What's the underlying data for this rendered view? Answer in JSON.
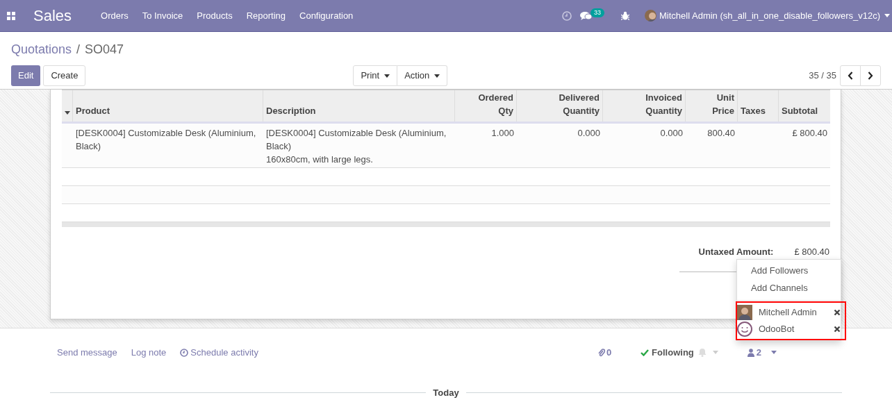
{
  "navbar": {
    "app_name": "Sales",
    "menu": [
      "Orders",
      "To Invoice",
      "Products",
      "Reporting",
      "Configuration"
    ],
    "messages_badge": "33",
    "user": "Mitchell Admin (sh_all_in_one_disable_followers_v12c)"
  },
  "breadcrumb": {
    "parent": "Quotations",
    "separator": "/",
    "current": "SO047"
  },
  "buttons": {
    "edit": "Edit",
    "create": "Create",
    "print": "Print",
    "action": "Action"
  },
  "pager": "35 / 35",
  "table": {
    "columns": [
      {
        "label": "Product"
      },
      {
        "label": "Description"
      },
      {
        "label": "Ordered Qty"
      },
      {
        "label": "Delivered Quantity"
      },
      {
        "label": "Invoiced Quantity"
      },
      {
        "label": "Unit Price"
      },
      {
        "label": "Taxes"
      },
      {
        "label": "Subtotal"
      }
    ],
    "rows": [
      {
        "cells": [
          "[DESK0004] Customizable Desk (Aluminium, Black)",
          "[DESK0004] Customizable Desk (Aluminium, Black)\n160x80cm, with large legs.",
          "1.000",
          "0.000",
          "0.000",
          "800.40",
          "",
          "£ 800.40"
        ]
      }
    ]
  },
  "totals": {
    "label": "Untaxed Amount:",
    "value": "£ 800.40"
  },
  "followers_menu": {
    "items": [
      "Add Followers",
      "Add Channels"
    ],
    "highlighted": true,
    "followers": [
      {
        "name": "Mitchell Admin",
        "kind": "photo"
      },
      {
        "name": "OdooBot",
        "kind": "smiley"
      }
    ]
  },
  "chatter": {
    "actions": [
      "Send message",
      "Log note",
      "Schedule activity"
    ],
    "attachments": "0",
    "following": "Following",
    "followers_count": "2",
    "divider": "Today"
  }
}
